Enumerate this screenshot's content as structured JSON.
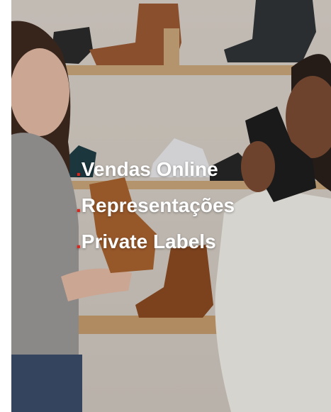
{
  "hero": {
    "bullet": ".",
    "accent_color": "#e0231b",
    "services": [
      {
        "label": "Vendas Online"
      },
      {
        "label": "Representações"
      },
      {
        "label": "Private Labels"
      }
    ]
  }
}
